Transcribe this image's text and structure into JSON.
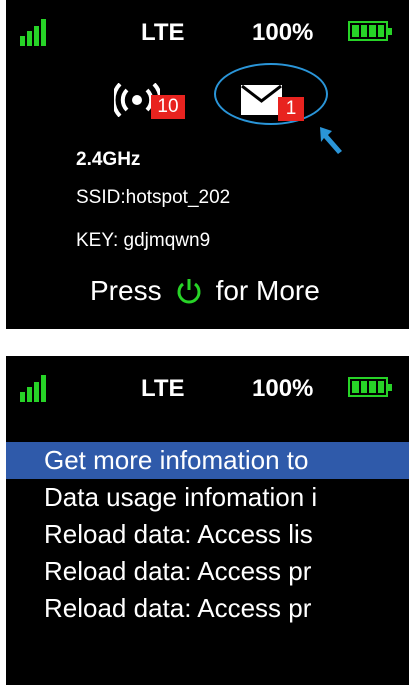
{
  "colors": {
    "signal": "#27d327",
    "badge": "#e8231f",
    "highlight": "#2a95d8",
    "menu_selected": "#2f5aaa"
  },
  "screen1": {
    "status": {
      "network": "LTE",
      "battery": "100%"
    },
    "wifi_clients": "10",
    "messages": "1",
    "frequency": "2.4GHz",
    "ssid": "SSID:hotspot_202",
    "key": "KEY: gdjmqwn9",
    "press_prefix": "Press",
    "press_suffix": "for More",
    "icons": [
      "signal-icon",
      "battery-icon",
      "wifi-hotspot-icon",
      "mail-icon",
      "arrow-icon",
      "power-icon"
    ]
  },
  "screen2": {
    "status": {
      "network": "LTE",
      "battery": "100%"
    },
    "menu": [
      {
        "label": "Get more infomation to",
        "selected": true
      },
      {
        "label": "Data usage infomation i",
        "selected": false
      },
      {
        "label": "Reload data: Access lis",
        "selected": false
      },
      {
        "label": "Reload data: Access pr",
        "selected": false
      },
      {
        "label": "Reload data: Access pr",
        "selected": false
      }
    ]
  }
}
